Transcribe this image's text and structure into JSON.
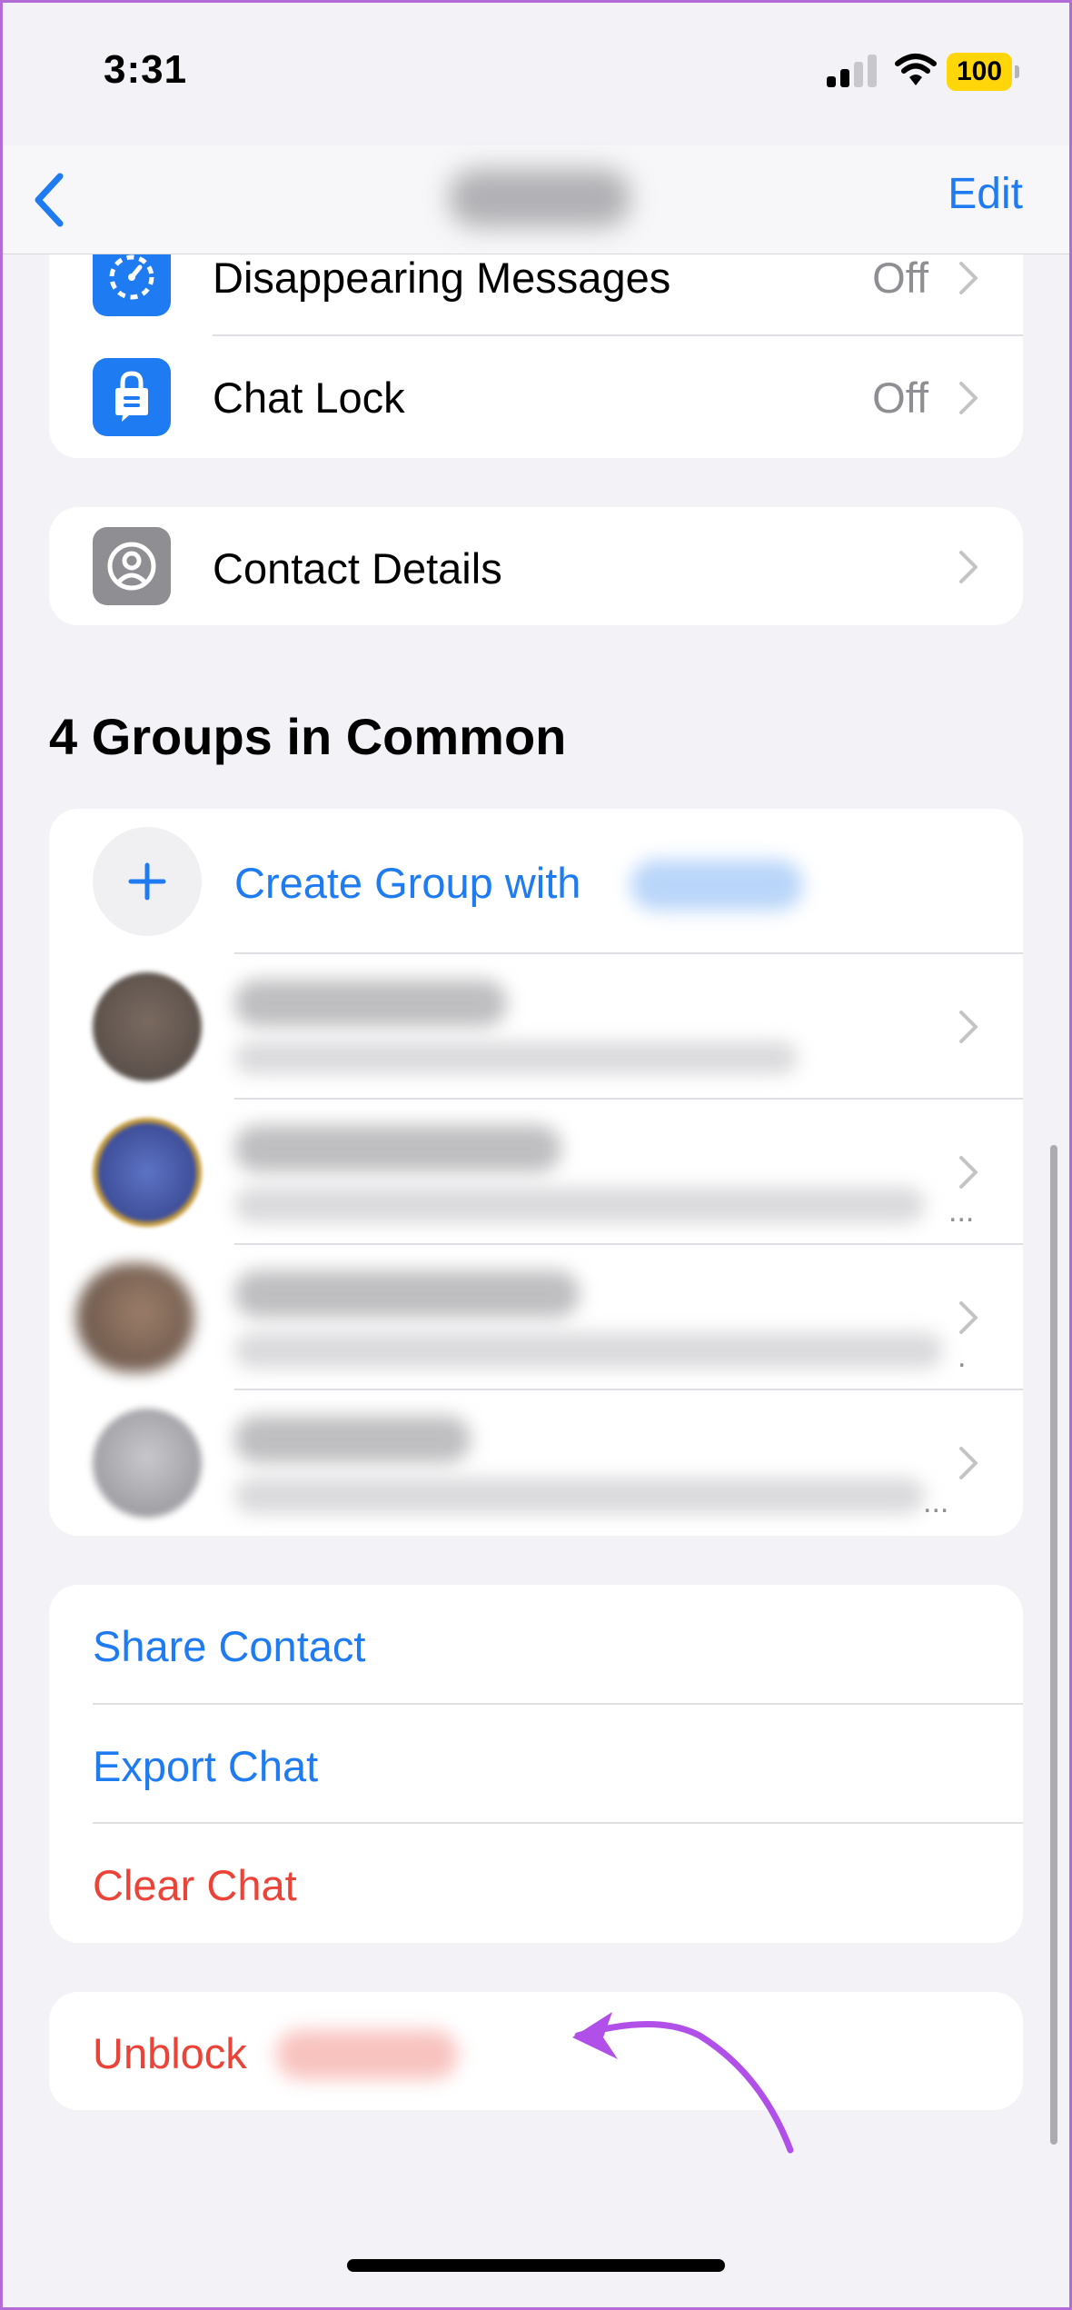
{
  "status_bar": {
    "time": "3:31",
    "battery": "100",
    "signal_bars_active": 2,
    "signal_bars_total": 4
  },
  "nav": {
    "back_icon": "chevron-left-icon",
    "edit_label": "Edit"
  },
  "settings_card": {
    "items": [
      {
        "icon": "timer-icon",
        "label": "Disappearing Messages",
        "value": "Off"
      },
      {
        "icon": "lock-chat-icon",
        "label": "Chat Lock",
        "value": "Off"
      }
    ]
  },
  "contact_details": {
    "icon": "person-icon",
    "label": "Contact Details"
  },
  "groups": {
    "title": "4 Groups in Common",
    "create_label": "Create Group with",
    "items": [
      {
        "ellipsis": ""
      },
      {
        "ellipsis": "..."
      },
      {
        "ellipsis": "."
      },
      {
        "ellipsis": "..."
      }
    ]
  },
  "actions": {
    "share_contact": "Share Contact",
    "export_chat": "Export Chat",
    "clear_chat": "Clear Chat"
  },
  "block": {
    "unblock_label": "Unblock"
  },
  "colors": {
    "accent_blue": "#1e7bf2",
    "destructive_red": "#eb4338",
    "annotation_purple": "#b150e8",
    "background": "#f2f2f7"
  }
}
